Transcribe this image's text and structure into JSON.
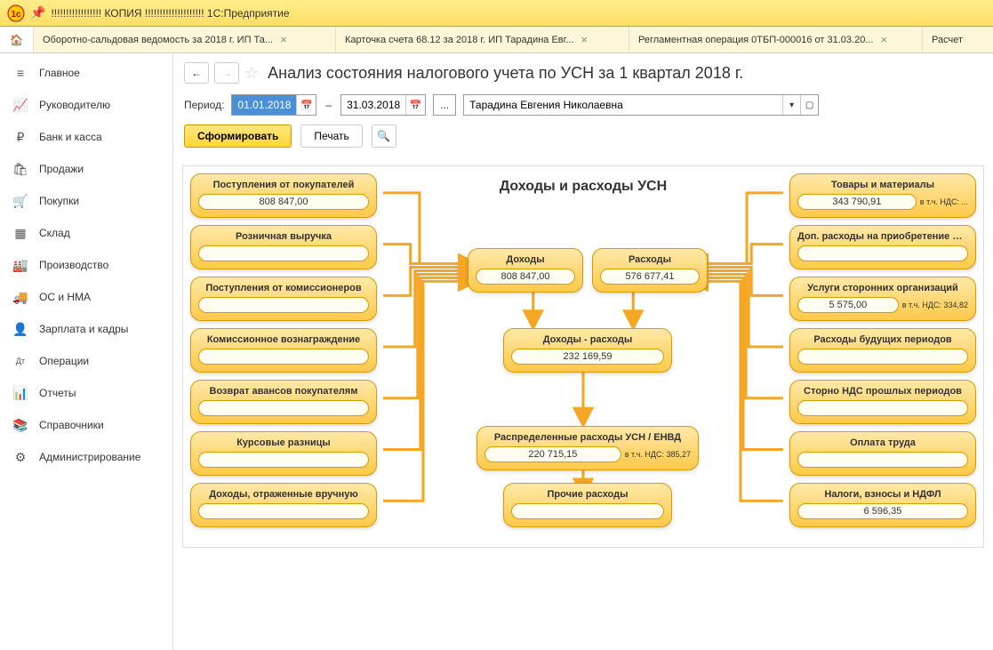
{
  "window": {
    "title": "!!!!!!!!!!!!!!!!! КОПИЯ !!!!!!!!!!!!!!!!!!!!  1С:Предприятие"
  },
  "tabs": [
    {
      "label": "Оборотно-сальдовая ведомость за 2018 г. ИП Та..."
    },
    {
      "label": "Карточка счета 68.12 за 2018 г. ИП Тарадина Евг..."
    },
    {
      "label": "Регламентная операция 0ТБП-000016 от 31.03.20..."
    },
    {
      "label": "Расчет"
    }
  ],
  "sidebar": {
    "items": [
      {
        "icon": "≡",
        "label": "Главное"
      },
      {
        "icon": "📈",
        "label": "Руководителю"
      },
      {
        "icon": "₽",
        "label": "Банк и касса"
      },
      {
        "icon": "🛍",
        "label": "Продажи"
      },
      {
        "icon": "🛒",
        "label": "Покупки"
      },
      {
        "icon": "▦",
        "label": "Склад"
      },
      {
        "icon": "🏭",
        "label": "Производство"
      },
      {
        "icon": "🚚",
        "label": "ОС и НМА"
      },
      {
        "icon": "👤",
        "label": "Зарплата и кадры"
      },
      {
        "icon": "Дт",
        "label": "Операции"
      },
      {
        "icon": "📊",
        "label": "Отчеты"
      },
      {
        "icon": "📚",
        "label": "Справочники"
      },
      {
        "icon": "⚙",
        "label": "Администрирование"
      }
    ]
  },
  "page": {
    "title": "Анализ состояния налогового учета по УСН за 1 квартал 2018 г.",
    "period_label": "Период:",
    "date_from": "01.01.2018",
    "date_to": "31.03.2018",
    "entity": "Тарадина Евгения Николаевна",
    "btn_form": "Сформировать",
    "btn_print": "Печать"
  },
  "diagram": {
    "title": "Доходы и расходы УСН",
    "left": [
      {
        "title": "Поступления от покупателей",
        "value": "808 847,00"
      },
      {
        "title": "Розничная выручка",
        "value": ""
      },
      {
        "title": "Поступления от комиссионеров",
        "value": ""
      },
      {
        "title": "Комиссионное вознаграждение",
        "value": ""
      },
      {
        "title": "Возврат авансов покупателям",
        "value": ""
      },
      {
        "title": "Курсовые разницы",
        "value": ""
      },
      {
        "title": "Доходы, отраженные вручную",
        "value": ""
      }
    ],
    "mid": {
      "income": {
        "title": "Доходы",
        "value": "808 847,00"
      },
      "expense": {
        "title": "Расходы",
        "value": "576 677,41"
      },
      "diff": {
        "title": "Доходы - расходы",
        "value": "232 169,59"
      },
      "dist": {
        "title": "Распределенные расходы УСН / ЕНВД",
        "value": "220 715,15",
        "note": "в т.ч. НДС: 385,27"
      },
      "other": {
        "title": "Прочие расходы",
        "value": ""
      }
    },
    "right": [
      {
        "title": "Товары и материалы",
        "value": "343 790,91",
        "note": "в т.ч. НДС: ..."
      },
      {
        "title": "Доп. расходы на приобретение ТМЦ",
        "value": ""
      },
      {
        "title": "Услуги сторонних организаций",
        "value": "5 575,00",
        "note": "в т.ч. НДС: 334,82"
      },
      {
        "title": "Расходы будущих периодов",
        "value": ""
      },
      {
        "title": "Сторно НДС прошлых периодов",
        "value": ""
      },
      {
        "title": "Оплата труда",
        "value": ""
      },
      {
        "title": "Налоги, взносы и НДФЛ",
        "value": "6 596,35"
      }
    ]
  }
}
